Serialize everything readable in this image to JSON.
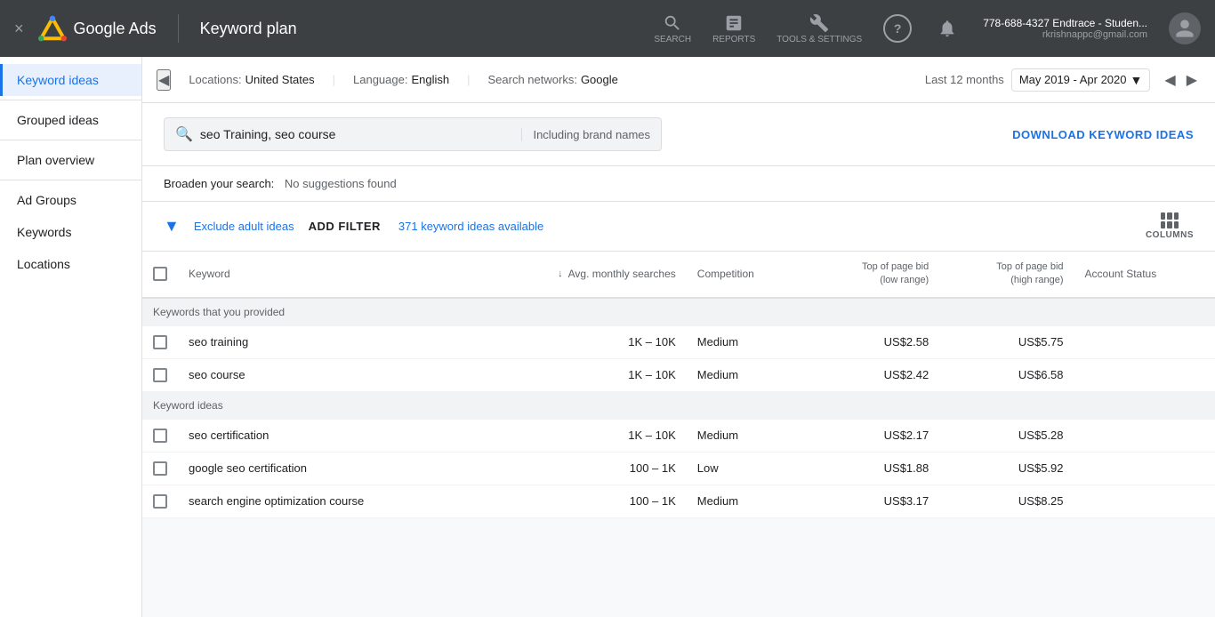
{
  "navbar": {
    "close_label": "×",
    "app_name": "Google Ads",
    "page_title": "Keyword plan",
    "actions": [
      {
        "id": "search",
        "label": "SEARCH"
      },
      {
        "id": "reports",
        "label": "REPORTS"
      },
      {
        "id": "tools",
        "label": "TOOLS & SETTINGS"
      }
    ],
    "user_phone": "778-688-4327 Endtrace - Studen...",
    "user_email": "rkrishnappc@gmail.com"
  },
  "topbar": {
    "back_label": "◀",
    "locations_label": "Locations:",
    "locations_value": "United States",
    "language_label": "Language:",
    "language_value": "English",
    "network_label": "Search networks:",
    "network_value": "Google",
    "date_range_label": "Last 12 months",
    "date_range_value": "May 2019 - Apr 2020"
  },
  "search": {
    "query": "seo Training, seo course",
    "brand_filter": "Including brand names",
    "download_label": "DOWNLOAD KEYWORD IDEAS"
  },
  "broaden": {
    "label": "Broaden your search:",
    "value": "No suggestions found"
  },
  "filter": {
    "exclude_label": "Exclude adult ideas",
    "add_filter_label": "ADD FILTER",
    "count_text": "371 keyword ideas available",
    "columns_label": "COLUMNS"
  },
  "table": {
    "headers": {
      "keyword": "Keyword",
      "avg_monthly": "Avg. monthly searches",
      "competition": "Competition",
      "top_bid_low": "Top of page bid (low range)",
      "top_bid_high": "Top of page bid (high range)",
      "account_status": "Account Status"
    },
    "section1_label": "Keywords that you provided",
    "section2_label": "Keyword ideas",
    "rows_provided": [
      {
        "keyword": "seo training",
        "avg_searches": "1K – 10K",
        "competition": "Medium",
        "bid_low": "US$2.58",
        "bid_high": "US$5.75",
        "status": ""
      },
      {
        "keyword": "seo course",
        "avg_searches": "1K – 10K",
        "competition": "Medium",
        "bid_low": "US$2.42",
        "bid_high": "US$6.58",
        "status": ""
      }
    ],
    "rows_ideas": [
      {
        "keyword": "seo certification",
        "avg_searches": "1K – 10K",
        "competition": "Medium",
        "bid_low": "US$2.17",
        "bid_high": "US$5.28",
        "status": ""
      },
      {
        "keyword": "google seo certification",
        "avg_searches": "100 – 1K",
        "competition": "Low",
        "bid_low": "US$1.88",
        "bid_high": "US$5.92",
        "status": ""
      },
      {
        "keyword": "search engine optimization course",
        "avg_searches": "100 – 1K",
        "competition": "Medium",
        "bid_low": "US$3.17",
        "bid_high": "US$8.25",
        "status": ""
      }
    ]
  },
  "sidebar": {
    "items": [
      {
        "id": "keyword-ideas",
        "label": "Keyword ideas",
        "active": true
      },
      {
        "id": "grouped-ideas",
        "label": "Grouped ideas",
        "active": false
      },
      {
        "id": "plan-overview",
        "label": "Plan overview",
        "active": false
      },
      {
        "id": "ad-groups",
        "label": "Ad Groups",
        "active": false
      },
      {
        "id": "keywords",
        "label": "Keywords",
        "active": false
      },
      {
        "id": "locations",
        "label": "Locations",
        "active": false
      }
    ]
  }
}
